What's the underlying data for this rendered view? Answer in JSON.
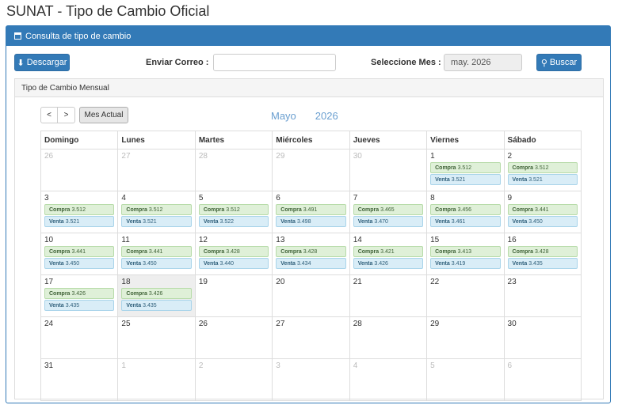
{
  "page_title": "SUNAT - Tipo de Cambio Oficial",
  "panel_title": "Consulta de tipo de cambio",
  "toolbar": {
    "download_label": "Descargar",
    "email_label": "Enviar Correo :",
    "email_value": "",
    "month_label": "Seleccione Mes :",
    "month_value": "may. 2026",
    "search_label": "Buscar"
  },
  "inner_title": "Tipo de Cambio Mensual",
  "nav": {
    "prev": "<",
    "next": ">",
    "today": "Mes Actual"
  },
  "calendar": {
    "month": "Mayo",
    "year": "2026",
    "days_of_week": [
      "Domingo",
      "Lunes",
      "Martes",
      "Miércoles",
      "Jueves",
      "Viernes",
      "Sábado"
    ],
    "compra_label": "Compra",
    "venta_label": "Venta",
    "weeks": [
      [
        {
          "day": "26",
          "other": true
        },
        {
          "day": "27",
          "other": true
        },
        {
          "day": "28",
          "other": true
        },
        {
          "day": "29",
          "other": true
        },
        {
          "day": "30",
          "other": true
        },
        {
          "day": "1",
          "compra": "3.512",
          "venta": "3.521"
        },
        {
          "day": "2",
          "compra": "3.512",
          "venta": "3.521"
        }
      ],
      [
        {
          "day": "3",
          "compra": "3.512",
          "venta": "3.521"
        },
        {
          "day": "4",
          "compra": "3.512",
          "venta": "3.521"
        },
        {
          "day": "5",
          "compra": "3.512",
          "venta": "3.522"
        },
        {
          "day": "6",
          "compra": "3.491",
          "venta": "3.498"
        },
        {
          "day": "7",
          "compra": "3.465",
          "venta": "3.470"
        },
        {
          "day": "8",
          "compra": "3.456",
          "venta": "3.461"
        },
        {
          "day": "9",
          "compra": "3.441",
          "venta": "3.450"
        }
      ],
      [
        {
          "day": "10",
          "compra": "3.441",
          "venta": "3.450"
        },
        {
          "day": "11",
          "compra": "3.441",
          "venta": "3.450"
        },
        {
          "day": "12",
          "compra": "3.428",
          "venta": "3.440"
        },
        {
          "day": "13",
          "compra": "3.428",
          "venta": "3.434"
        },
        {
          "day": "14",
          "compra": "3.421",
          "venta": "3.426"
        },
        {
          "day": "15",
          "compra": "3.413",
          "venta": "3.419"
        },
        {
          "day": "16",
          "compra": "3.428",
          "venta": "3.435"
        }
      ],
      [
        {
          "day": "17",
          "compra": "3.426",
          "venta": "3.435"
        },
        {
          "day": "18",
          "compra": "3.426",
          "venta": "3.435",
          "today": true
        },
        {
          "day": "19"
        },
        {
          "day": "20"
        },
        {
          "day": "21"
        },
        {
          "day": "22"
        },
        {
          "day": "23"
        }
      ],
      [
        {
          "day": "24"
        },
        {
          "day": "25"
        },
        {
          "day": "26"
        },
        {
          "day": "27"
        },
        {
          "day": "28"
        },
        {
          "day": "29"
        },
        {
          "day": "30"
        }
      ],
      [
        {
          "day": "31"
        },
        {
          "day": "1",
          "other": true
        },
        {
          "day": "2",
          "other": true
        },
        {
          "day": "3",
          "other": true
        },
        {
          "day": "4",
          "other": true
        },
        {
          "day": "5",
          "other": true
        },
        {
          "day": "6",
          "other": true
        }
      ]
    ]
  }
}
